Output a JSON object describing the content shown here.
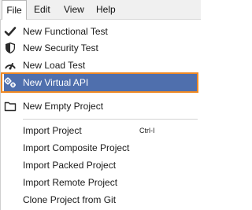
{
  "menubar": {
    "items": [
      {
        "label": "File"
      },
      {
        "label": "Edit"
      },
      {
        "label": "View"
      },
      {
        "label": "Help"
      }
    ]
  },
  "file_menu": {
    "items": [
      {
        "label": "New Functional Test",
        "icon": "checkmark-icon"
      },
      {
        "label": "New Security Test",
        "icon": "shield-icon"
      },
      {
        "label": "New Load Test",
        "icon": "load-test-icon"
      },
      {
        "label": "New Virtual API",
        "icon": "virtual-api-icon",
        "highlighted": true
      },
      {
        "label": "New Empty Project",
        "icon": "folder-icon"
      },
      {
        "label": "Import Project",
        "shortcut": "Ctrl-I"
      },
      {
        "label": "Import Composite Project"
      },
      {
        "label": "Import Packed Project"
      },
      {
        "label": "Import Remote Project"
      },
      {
        "label": "Clone Project from Git"
      }
    ]
  },
  "colors": {
    "highlight": "#4f6fad",
    "highlight_border": "#f08a24",
    "menubar_bg": "#f0f0f0"
  }
}
